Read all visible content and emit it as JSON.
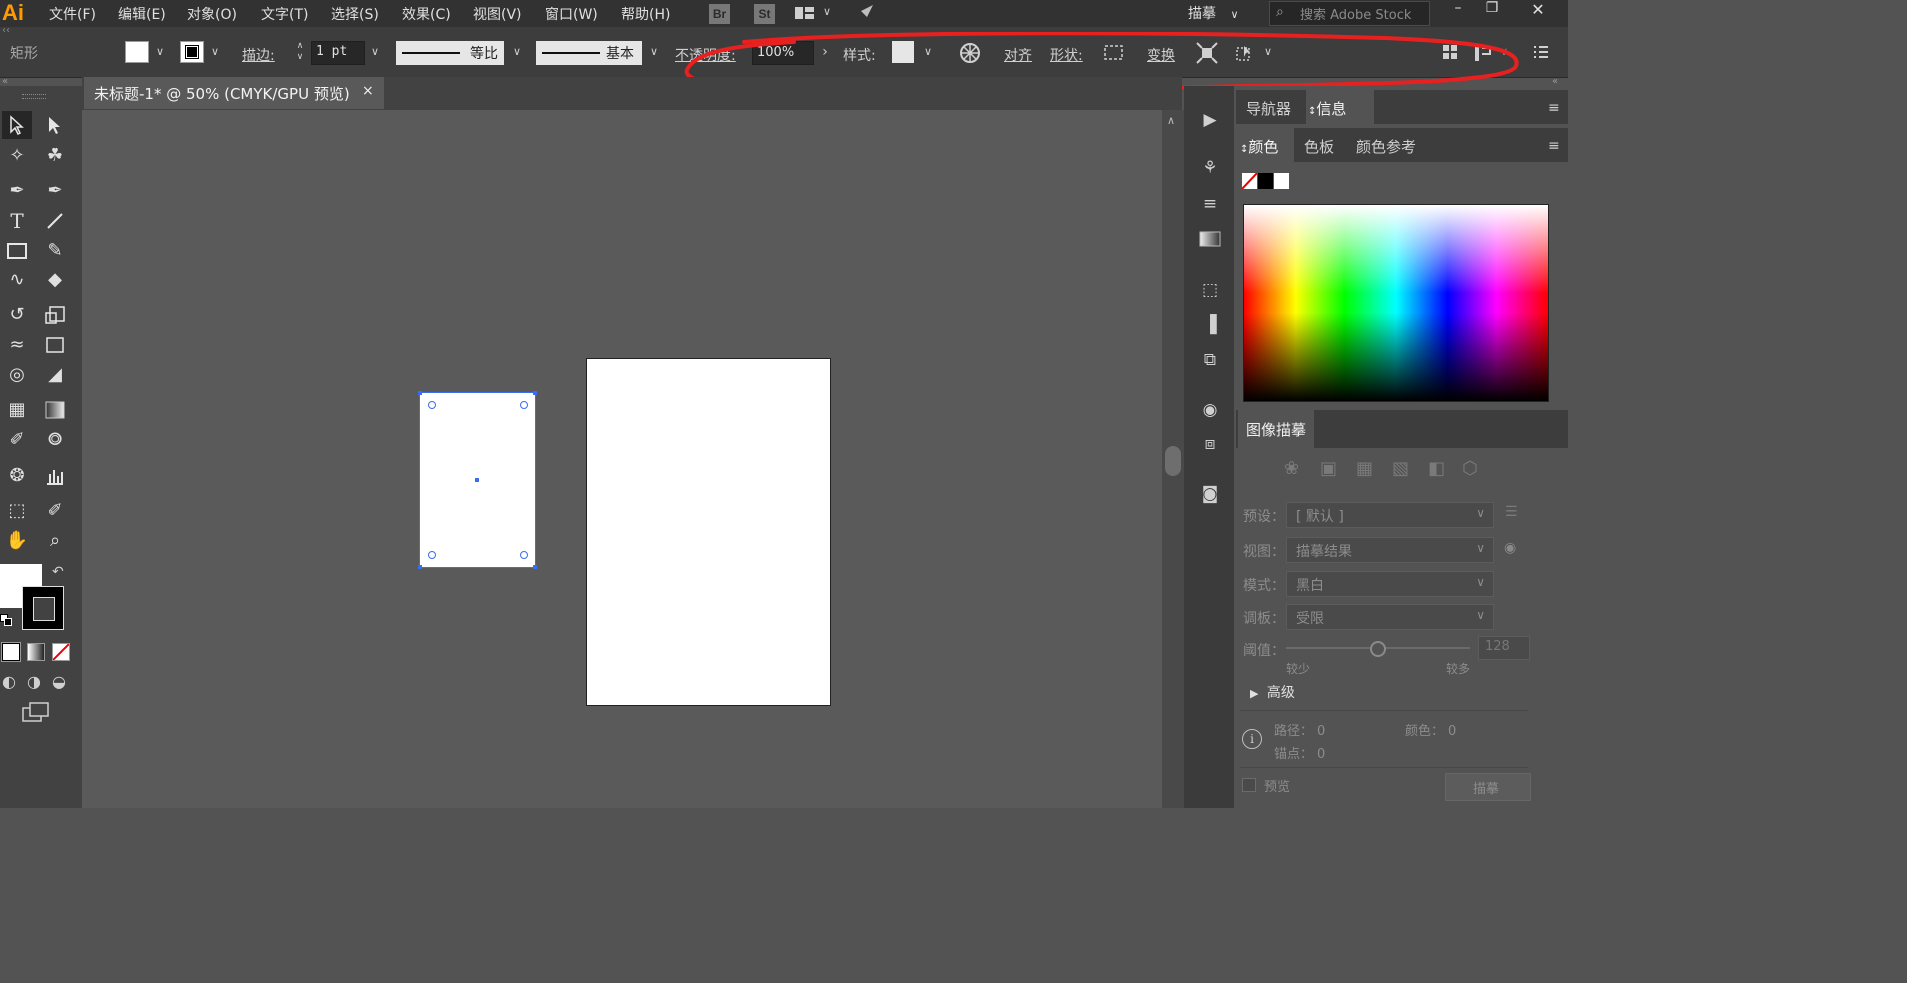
{
  "app": {
    "logo": "Ai"
  },
  "menubar": {
    "items": [
      "文件(F)",
      "编辑(E)",
      "对象(O)",
      "文字(T)",
      "选择(S)",
      "效果(C)",
      "视图(V)",
      "窗口(W)",
      "帮助(H)"
    ],
    "bridge_label": "Br",
    "stock_label": "St",
    "workspace_label": "描摹",
    "search_placeholder": "搜索 Adobe Stock"
  },
  "control_bar": {
    "selection_type": "矩形",
    "stroke_label": "描边",
    "stroke_weight": "1 pt",
    "profile_label": "等比",
    "brush_label": "基本",
    "opacity_label": "不透明度",
    "opacity_value": "100%",
    "style_label": "样式",
    "align_label": "对齐",
    "shape_label": "形状",
    "transform_label": "变换",
    "colons": [
      ":",
      ":",
      ":",
      ":"
    ]
  },
  "document": {
    "tab_title": "未标题-1* @ 50% (CMYK/GPU 预览)",
    "close_glyph": "×"
  },
  "panels": {
    "nav_tabs": [
      "导航器",
      "信息"
    ],
    "color_tabs": [
      "颜色",
      "色板",
      "颜色参考"
    ],
    "trace": {
      "title": "图像描摹",
      "preset_label": "预设",
      "preset_value": "[ 默认 ]",
      "view_label": "视图",
      "view_value": "描摹结果",
      "mode_label": "模式",
      "mode_value": "黑白",
      "palette_label": "调板",
      "palette_value": "受限",
      "threshold_label": "阈值",
      "threshold_value": "128",
      "threshold_fraction": 0.5,
      "less_label": "较少",
      "more_label": "较多",
      "advanced_label": "高级",
      "paths_label": "路径：",
      "paths_value": "0",
      "colors_label": "颜色：",
      "colors_value": "0",
      "anchors_label": "锚点：",
      "anchors_value": "0",
      "preview_label": "预览",
      "trace_button": "描摹"
    }
  },
  "colors": {
    "annotation": "#e82020",
    "selection": "#3a6df0",
    "accent": "#ff9a00"
  }
}
